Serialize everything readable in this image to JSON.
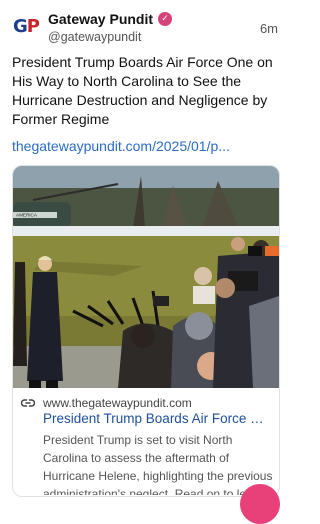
{
  "account": {
    "avatar_text_g": "G",
    "avatar_text_p": "P",
    "name": "Gateway Pundit",
    "handle": "@gatewaypundit",
    "time": "6m"
  },
  "post": {
    "text": "President Trump Boards Air Force One on His Way to North Carolina to See the Hurricane Destruction and Negligence by Former Regime",
    "link": "thegatewaypundit.com/2025/01/p..."
  },
  "card": {
    "domain": "www.thegatewaypundit.com",
    "title": "President Trump Boards Air Force On...",
    "description": "President Trump is set to visit North Carolina to assess the aftermath of Hurricane Helene, highlighting the previous administration's neglect. Read on to learn more about his pla..."
  },
  "photo": {
    "helicopter_marking": "AMERICA"
  },
  "colors": {
    "link": "#2a6cc4",
    "card_title": "#1f4f9a",
    "verified_badge": "#d6427a",
    "fab": "#e8417a"
  }
}
